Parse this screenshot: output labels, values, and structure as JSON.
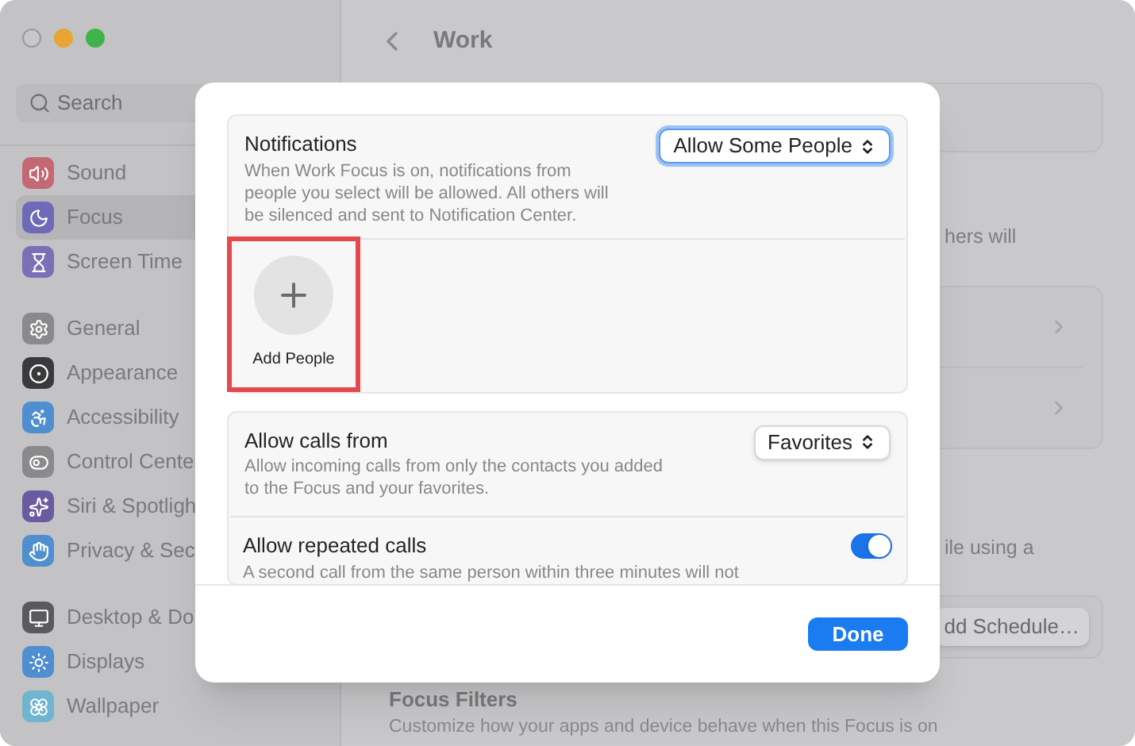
{
  "sidebar": {
    "search": {
      "placeholder": "Search"
    },
    "groups": [
      [
        {
          "label": "Sound",
          "selected": false
        },
        {
          "label": "Focus",
          "selected": true
        },
        {
          "label": "Screen Time",
          "selected": false
        }
      ],
      [
        {
          "label": "General",
          "selected": false
        },
        {
          "label": "Appearance",
          "selected": false
        },
        {
          "label": "Accessibility",
          "selected": false
        },
        {
          "label": "Control Cente",
          "selected": false
        },
        {
          "label": "Siri & Spotligh",
          "selected": false
        },
        {
          "label": "Privacy & Sec",
          "selected": false
        }
      ],
      [
        {
          "label": "Desktop & Do",
          "selected": false
        },
        {
          "label": "Displays",
          "selected": false
        },
        {
          "label": "Wallpaper",
          "selected": false
        }
      ]
    ]
  },
  "main": {
    "title": "Work",
    "notifications_text": "hers will",
    "schedule_text": "ile using a",
    "schedule_button": "dd Schedule…",
    "focus_filters": {
      "title": "Focus Filters",
      "description": "Customize how your apps and device behave when this Focus is on"
    }
  },
  "dialog": {
    "notifications": {
      "title": "Notifications",
      "description": "When Work Focus is on, notifications from people you select will be allowed. All others will be silenced and sent to Notification Center.",
      "select": "Allow Some People",
      "add_people": "Add People",
      "highlighted": true
    },
    "calls": {
      "title": "Allow calls from",
      "description": "Allow incoming calls from only the contacts you added to the Focus and your favorites.",
      "select": "Favorites"
    },
    "repeated": {
      "title": "Allow repeated calls",
      "description": "A second call from the same person within three minutes will not",
      "on": true
    },
    "done": "Done"
  }
}
